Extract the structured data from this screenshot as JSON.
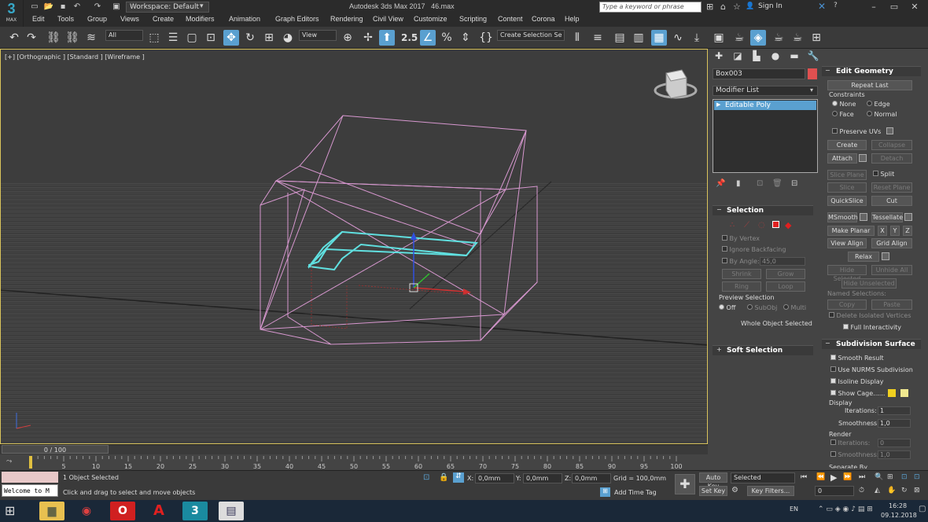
{
  "app": {
    "logo_main": "3",
    "logo_sub": "MAX",
    "title": "Autodesk 3ds Max 2017",
    "file": "46.max",
    "workspace": "Workspace: Default",
    "search_placeholder": "Type a keyword or phrase",
    "sign_in": "Sign In"
  },
  "menu": [
    "Edit",
    "Tools",
    "Group",
    "Views",
    "Create",
    "Modifiers",
    "Animation",
    "Graph Editors",
    "Rendering",
    "Civil View",
    "Customize",
    "Scripting",
    "Content",
    "Corona",
    "Help"
  ],
  "toolbar": {
    "selection_filter": "All",
    "ref_coord": "View",
    "snaps_label": "2.5",
    "named_selection": "Create Selection Se"
  },
  "viewport": {
    "label": "[+] [Orthographic ] [Standard ] [Wireframe ]"
  },
  "command_panel": {
    "object_name": "Box003",
    "modifier_list": "Modifier List",
    "stack_item": "Editable Poly",
    "selection": {
      "title": "Selection",
      "by_vertex": "By Vertex",
      "ignore_backfacing": "Ignore Backfacing",
      "by_angle": "By Angle:",
      "angle_value": "45,0",
      "shrink": "Shrink",
      "grow": "Grow",
      "ring": "Ring",
      "loop": "Loop",
      "preview_title": "Preview Selection",
      "off": "Off",
      "subobj": "SubObj",
      "multi": "Multi",
      "status": "Whole Object Selected"
    },
    "soft_selection": "Soft Selection"
  },
  "edit_geometry": {
    "title": "Edit Geometry",
    "repeat_last": "Repeat Last",
    "constraints": "Constraints",
    "none": "None",
    "edge": "Edge",
    "face": "Face",
    "normal": "Normal",
    "preserve_uvs": "Preserve UVs",
    "create": "Create",
    "collapse": "Collapse",
    "attach": "Attach",
    "detach": "Detach",
    "slice_plane": "Slice Plane",
    "split": "Split",
    "slice": "Slice",
    "reset_plane": "Reset Plane",
    "quickslice": "QuickSlice",
    "cut": "Cut",
    "msmooth": "MSmooth",
    "tessellate": "Tessellate",
    "make_planar": "Make Planar",
    "x": "X",
    "y": "Y",
    "z": "Z",
    "view_align": "View Align",
    "grid_align": "Grid Align",
    "relax": "Relax",
    "hide_selected": "Hide Selected",
    "unhide_all": "Unhide All",
    "hide_unselected": "Hide Unselected",
    "named_selections": "Named Selections:",
    "copy": "Copy",
    "paste": "Paste",
    "delete_isolated": "Delete Isolated Vertices",
    "full_interactivity": "Full Interactivity"
  },
  "subdivision": {
    "title": "Subdivision Surface",
    "smooth_result": "Smooth Result",
    "use_nurms": "Use NURMS Subdivision",
    "isoline": "Isoline Display",
    "show_cage": "Show Cage......",
    "display": "Display",
    "iterations": "Iterations:",
    "iterations_value": "1",
    "smoothness": "Smoothness:",
    "smoothness_value": "1,0",
    "render": "Render",
    "r_iterations_value": "0",
    "r_smoothness_value": "1,0",
    "separate_by": "Separate By",
    "cage_color1": "#f0d020",
    "cage_color2": "#f0e890"
  },
  "timeline": {
    "frame": "0 / 100",
    "ticks": [
      "5",
      "10",
      "15",
      "20",
      "25",
      "30",
      "35",
      "40",
      "45",
      "50",
      "55",
      "60",
      "65",
      "70",
      "75",
      "80",
      "85",
      "90",
      "95",
      "100"
    ]
  },
  "status": {
    "objects_selected": "1 Object Selected",
    "prompt": "Click and drag to select and move objects",
    "maxscript": "Welcome to M",
    "x_label": "X:",
    "x_value": "0,0mm",
    "y_label": "Y:",
    "y_value": "0,0mm",
    "z_label": "Z:",
    "z_value": "0,0mm",
    "grid": "Grid = 100,0mm",
    "add_time_tag": "Add Time Tag",
    "auto_key": "Auto Key",
    "set_key": "Set Key",
    "key_mode": "Selected",
    "key_filters": "Key Filters...",
    "current_frame": "0"
  },
  "taskbar": {
    "lang": "EN",
    "time": "16:28",
    "date": "09.12.2018"
  }
}
